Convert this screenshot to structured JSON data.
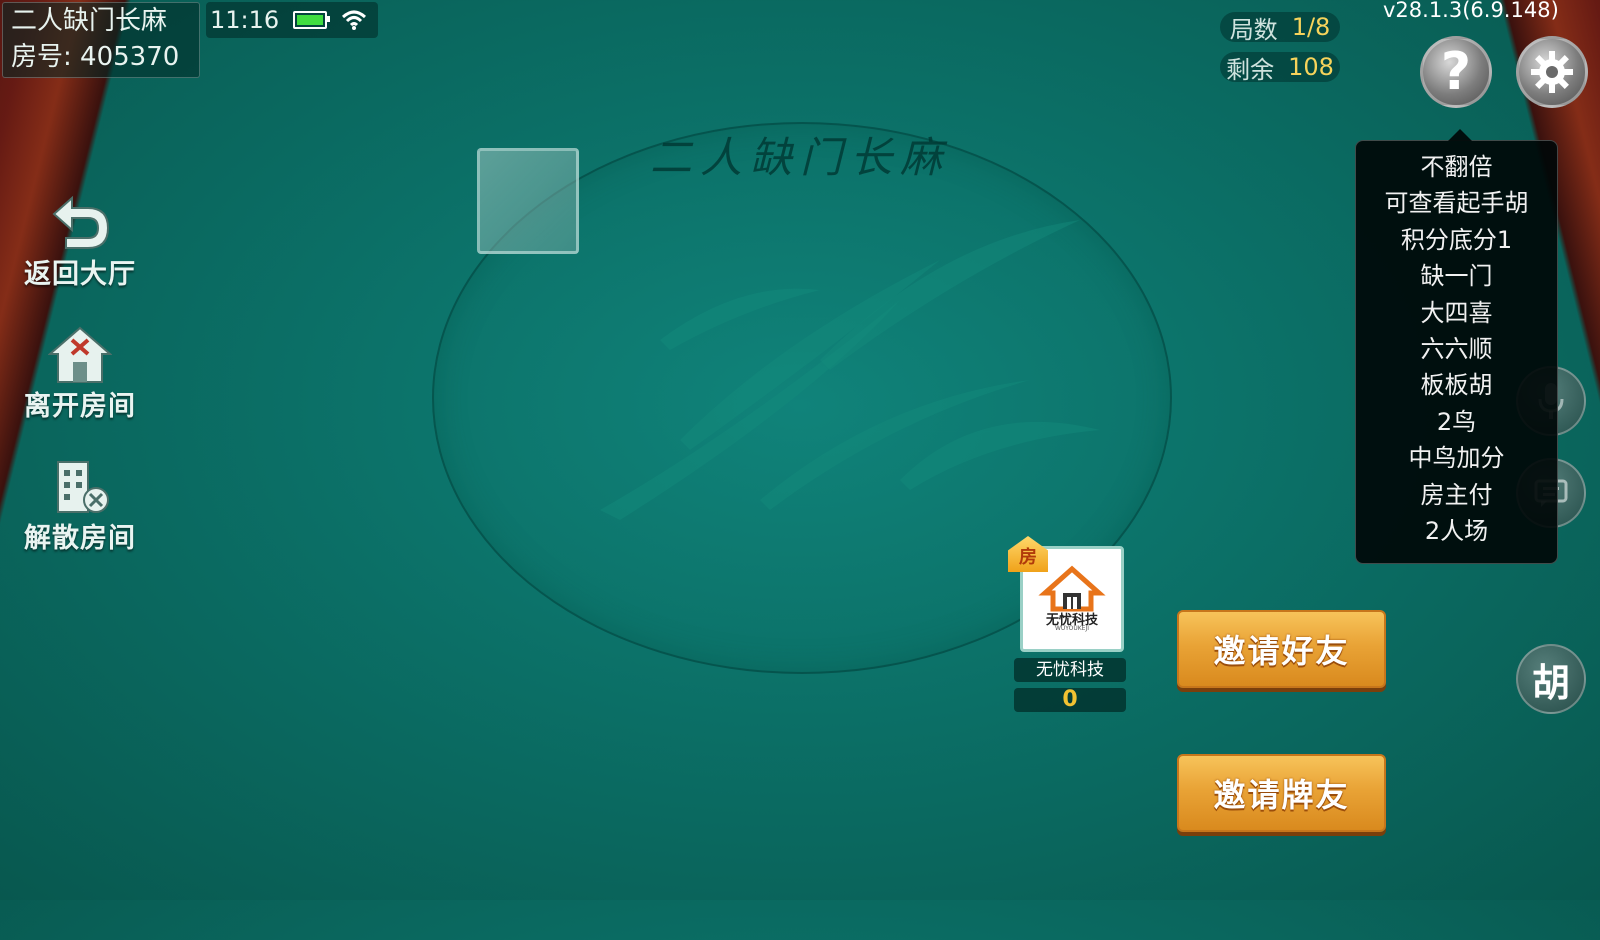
{
  "room": {
    "game_name": "二人缺门长麻",
    "room_label": "房号:",
    "room_number": "405370"
  },
  "status_bar": {
    "time": "11:16",
    "battery_icon": "battery-icon",
    "wifi_icon": "wifi-icon"
  },
  "version": "v28.1.3(6.9.148)",
  "counters": {
    "rounds_label": "局数",
    "rounds_value": "1/8",
    "remaining_label": "剩余",
    "remaining_value": "108"
  },
  "left_menu": {
    "back_label": "返回大厅",
    "leave_label": "离开房间",
    "dissolve_label": "解散房间"
  },
  "table": {
    "title": "二人缺门长麻"
  },
  "top_buttons": {
    "help_icon": "help-icon",
    "settings_icon": "gear-icon"
  },
  "rules": [
    "不翻倍",
    "可查看起手胡",
    "积分底分1",
    "缺一门",
    "大四喜",
    "六六顺",
    "板板胡",
    "2鸟",
    "中鸟加分",
    "房主付",
    "2人场"
  ],
  "side_controls": {
    "mic_icon": "microphone-icon",
    "chat_icon": "chat-icon",
    "hu_label": "胡"
  },
  "player": {
    "owner_badge": "房",
    "avatar_brand": "无忧科技",
    "avatar_sub": "WUYOUKEJI",
    "name": "无忧科技",
    "score": "0"
  },
  "invite": {
    "friends_label": "邀请好友",
    "card_friends_label": "邀请牌友"
  },
  "colors": {
    "felt": "#0b6f66",
    "accent_gold": "#f6d35b",
    "invite_button": "#e9a336"
  }
}
